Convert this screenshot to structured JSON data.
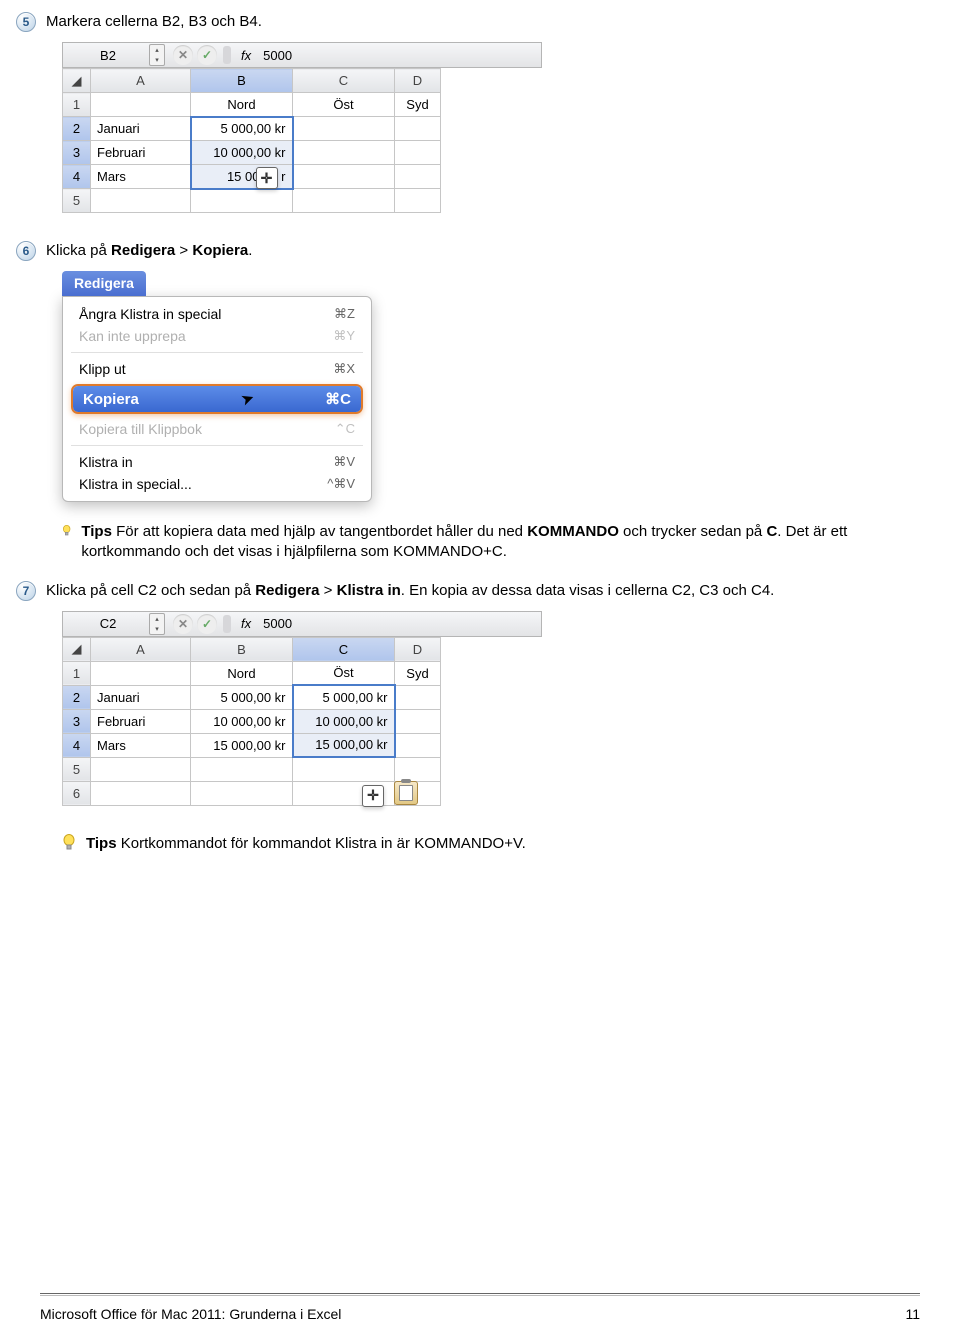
{
  "steps": {
    "s5": {
      "num": "5",
      "text_pre": "Markera cellerna B2, B3 och B4."
    },
    "s6": {
      "num": "6",
      "text_pre": "Klicka på ",
      "bold1": "Redigera",
      "mid": " > ",
      "bold2": "Kopiera",
      "text_post": "."
    },
    "s7": {
      "num": "7",
      "text_pre": "Klicka på cell C2 och sedan på ",
      "bold1": "Redigera",
      "mid": " > ",
      "bold2": "Klistra in",
      "text_post": ". En kopia av dessa data visas i cellerna C2, C3 och C4."
    }
  },
  "fb1": {
    "name": "B2",
    "fx": "fx",
    "value": "5000"
  },
  "fb2": {
    "name": "C2",
    "fx": "fx",
    "value": "5000"
  },
  "cols": {
    "A": "A",
    "B": "B",
    "C": "C",
    "D": "D"
  },
  "rows": [
    "1",
    "2",
    "3",
    "4",
    "5",
    "6"
  ],
  "headers": {
    "nord": "Nord",
    "ost": "Öst",
    "syd": "Syd"
  },
  "months": {
    "jan": "Januari",
    "feb": "Februari",
    "mar": "Mars"
  },
  "vals": {
    "v5": "5 000,00 kr",
    "v10": "10 000,00 kr",
    "v15": "15 000,00 kr",
    "v15_cursor": "15 000,0   r"
  },
  "menu": {
    "title": "Redigera",
    "undo": "Ångra Klistra in special",
    "undo_sc": "⌘Z",
    "redo": "Kan inte upprepa",
    "redo_sc": "⌘Y",
    "cut": "Klipp ut",
    "cut_sc": "⌘X",
    "copy": "Kopiera",
    "copy_sc": "⌘C",
    "copyto": "Kopiera till Klippbok",
    "copyto_sc": "⌃C",
    "paste": "Klistra in",
    "paste_sc": "⌘V",
    "pastesp": "Klistra in special...",
    "pastesp_sc": "^⌘V"
  },
  "tips": {
    "label": "Tips",
    "t1a": "  För att kopiera data med hjälp av tangentbordet håller du ned ",
    "t1b": "KOMMANDO",
    "t1c": " och trycker sedan på ",
    "t1d": "C",
    "t1e": ". Det är ett kortkommando och det visas i hjälpfilerna som KOMMANDO+C.",
    "t2": "  Kortkommandot för kommandot Klistra in är KOMMANDO+V."
  },
  "footer": {
    "left": "Microsoft Office för Mac 2011: Grunderna i Excel",
    "right": "11"
  },
  "icons": {
    "cursor_plus": "✛"
  }
}
